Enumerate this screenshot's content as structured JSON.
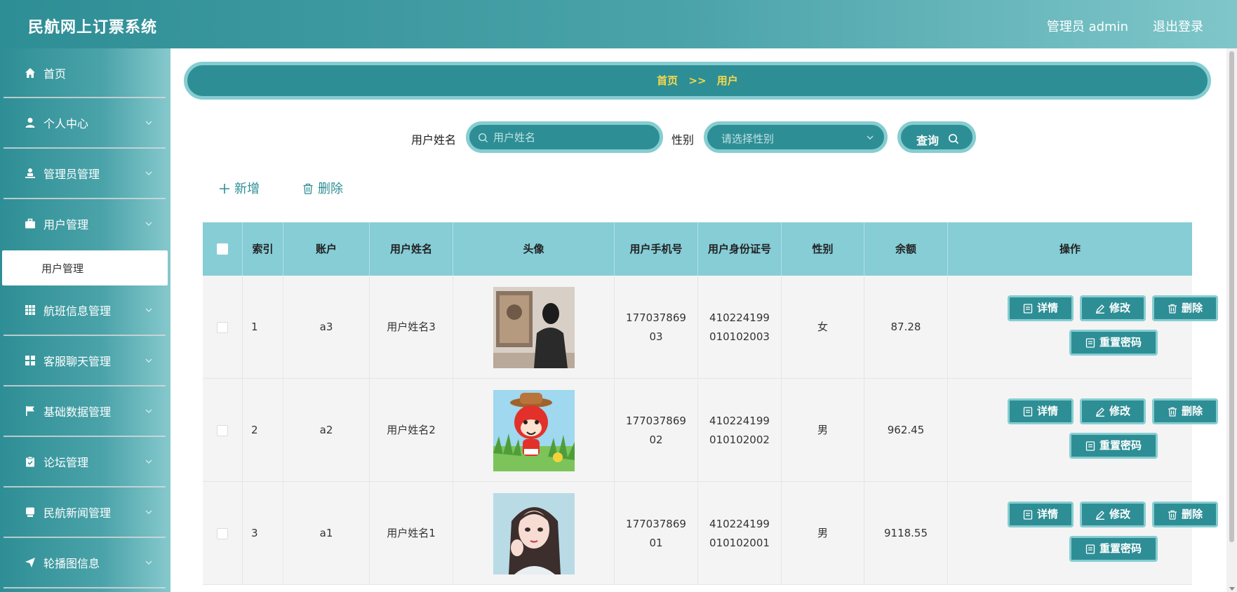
{
  "header": {
    "title": "民航网上订票系统",
    "user": "管理员 admin",
    "logout": "退出登录"
  },
  "sidebar": {
    "items": [
      {
        "label": "首页",
        "icon": "home-icon"
      },
      {
        "label": "个人中心",
        "icon": "user-icon"
      },
      {
        "label": "管理员管理",
        "icon": "admin-icon"
      },
      {
        "label": "用户管理",
        "icon": "briefcase-icon"
      },
      {
        "label": "航班信息管理",
        "icon": "grid-icon"
      },
      {
        "label": "客服聊天管理",
        "icon": "apps-icon"
      },
      {
        "label": "基础数据管理",
        "icon": "flag-icon"
      },
      {
        "label": "论坛管理",
        "icon": "clipboard-icon"
      },
      {
        "label": "民航新闻管理",
        "icon": "news-icon"
      },
      {
        "label": "轮播图信息",
        "icon": "send-icon"
      }
    ],
    "submenu_active": "用户管理"
  },
  "breadcrumb": {
    "home": "首页",
    "separator": ">>",
    "current": "用户"
  },
  "search": {
    "name_label": "用户姓名",
    "name_placeholder": "用户姓名",
    "gender_label": "性别",
    "gender_placeholder": "请选择性别",
    "query_label": "查询"
  },
  "actions": {
    "add": "新增",
    "delete": "删除"
  },
  "table": {
    "columns": [
      "索引",
      "账户",
      "用户姓名",
      "头像",
      "用户手机号",
      "用户身份证号",
      "性别",
      "余额",
      "操作"
    ],
    "rows": [
      {
        "index": "1",
        "account": "a3",
        "name": "用户姓名3",
        "avatar": "photo-man-viewing-painting",
        "phone": "17703786903",
        "id_card": "410224199010102003",
        "gender": "女",
        "balance": "87.28"
      },
      {
        "index": "2",
        "account": "a2",
        "name": "用户姓名2",
        "avatar": "cartoon-fox-with-hat",
        "phone": "17703786902",
        "id_card": "410224199010102002",
        "gender": "男",
        "balance": "962.45"
      },
      {
        "index": "3",
        "account": "a1",
        "name": "用户姓名1",
        "avatar": "illustrated-girl-portrait",
        "phone": "17703786901",
        "id_card": "410224199010102001",
        "gender": "男",
        "balance": "9118.55"
      }
    ],
    "row_buttons": {
      "detail": "详情",
      "edit": "修改",
      "delete": "删除",
      "reset_password": "重置密码"
    }
  },
  "colors": {
    "primary": "#2e8e95",
    "primary_light": "#86cdd1",
    "table_header": "#86cdd6",
    "breadcrumb_text": "#f7d94c"
  }
}
